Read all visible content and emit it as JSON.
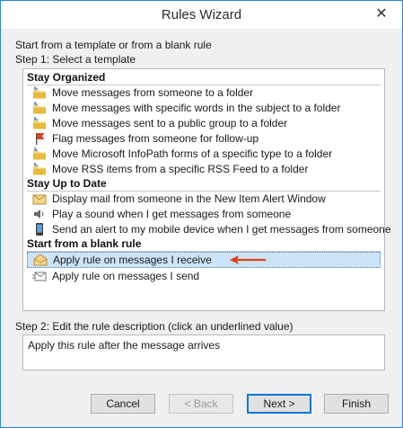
{
  "window": {
    "title": "Rules Wizard",
    "close_glyph": "✕"
  },
  "intro": "Start from a template or from a blank rule",
  "step1_label": "Step 1: Select a template",
  "groups": [
    {
      "name": "Stay Organized",
      "items": [
        {
          "label": "Move messages from someone to a folder",
          "icon": "folder-arrow-icon"
        },
        {
          "label": "Move messages with specific words in the subject to a folder",
          "icon": "folder-arrow-icon"
        },
        {
          "label": "Move messages sent to a public group to a folder",
          "icon": "folder-arrow-icon"
        },
        {
          "label": "Flag messages from someone for follow-up",
          "icon": "flag-icon"
        },
        {
          "label": "Move Microsoft InfoPath forms of a specific type to a folder",
          "icon": "folder-arrow-icon"
        },
        {
          "label": "Move RSS items from a specific RSS Feed to a folder",
          "icon": "folder-arrow-icon"
        }
      ]
    },
    {
      "name": "Stay Up to Date",
      "items": [
        {
          "label": "Display mail from someone in the New Item Alert Window",
          "icon": "envelope-alert-icon"
        },
        {
          "label": "Play a sound when I get messages from someone",
          "icon": "speaker-icon"
        },
        {
          "label": "Send an alert to my mobile device when I get messages from someone",
          "icon": "mobile-device-icon"
        }
      ]
    },
    {
      "name": "Start from a blank rule",
      "items": [
        {
          "label": "Apply rule on messages I receive",
          "icon": "open-envelope-icon",
          "selected": true
        },
        {
          "label": "Apply rule on messages I send",
          "icon": "send-envelope-icon"
        }
      ]
    }
  ],
  "step2_label": "Step 2: Edit the rule description (click an underlined value)",
  "description": "Apply this rule after the message arrives",
  "buttons": {
    "cancel": "Cancel",
    "back": "< Back",
    "next": "Next >",
    "finish": "Finish"
  },
  "colors": {
    "accent": "#2b82d9",
    "selection": "#cce4f7",
    "annotation_arrow": "#e0401a"
  }
}
